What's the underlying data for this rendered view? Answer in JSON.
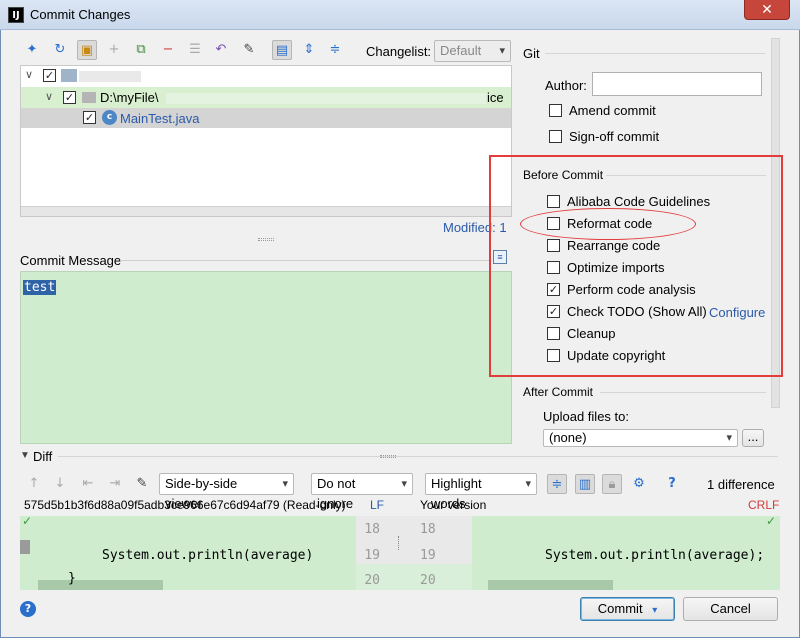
{
  "window": {
    "title": "Commit Changes",
    "app_icon": "intellij-icon",
    "close_glyph": "✕"
  },
  "toolbar": {
    "icons": [
      "show-diff-icon",
      "refresh-icon",
      "group-by-icon",
      "add-icon",
      "move-icon",
      "remove-icon",
      "rollback-tb-icon",
      "revert-icon",
      "edit-source-icon",
      "collapse-icon",
      "expand-all-icon",
      "collapse-all-icon"
    ],
    "changelist_label": "Changelist:",
    "changelist_value": "Default"
  },
  "tree": {
    "root_expand": "∨",
    "path_expand": "∨",
    "path_prefix": "D:\\myFile\\",
    "path_suffix": "ice",
    "file_name": "MainTest.java"
  },
  "modified_label": "Modified: 1",
  "commit_message": {
    "label": "Commit Message",
    "value": "test"
  },
  "git": {
    "section_title": "Git",
    "author_label": "Author:",
    "author_value": "",
    "amend_label": "Amend commit",
    "signoff_label": "Sign-off commit"
  },
  "before_commit": {
    "title": "Before Commit",
    "options": [
      {
        "label": "Alibaba Code Guidelines",
        "checked": false
      },
      {
        "label": "Reformat code",
        "checked": false
      },
      {
        "label": "Rearrange code",
        "checked": false
      },
      {
        "label": "Optimize imports",
        "checked": false
      },
      {
        "label": "Perform code analysis",
        "checked": true
      },
      {
        "label": "Check TODO (Show All)",
        "checked": true
      },
      {
        "label": "Cleanup",
        "checked": false
      },
      {
        "label": "Update copyright",
        "checked": false
      }
    ],
    "configure_link": "Configure"
  },
  "after_commit": {
    "title": "After Commit",
    "upload_label": "Upload files to:",
    "upload_value": "(none)",
    "browse_label": "..."
  },
  "diff": {
    "title": "Diff",
    "viewer": "Side-by-side viewer",
    "whitespace": "Do not ignore",
    "highlight": "Highlight words",
    "difference_count": "1 difference",
    "left_header": "575d5b1b3f6d88a09f5adb3ce966e67c6d94af79 (Read-only)",
    "left_line_sep": "LF",
    "right_header": "Your version",
    "right_line_sep": "CRLF",
    "left_lines": [
      "18",
      "19",
      "20"
    ],
    "right_lines": [
      "18",
      "19",
      "20"
    ],
    "left_code": "System.out.println(average)",
    "right_code": "System.out.println(average);",
    "left_brace": "}"
  },
  "buttons": {
    "commit": "Commit",
    "cancel": "Cancel",
    "help": "?"
  },
  "colors": {
    "highlight_box": "#e23c3c",
    "diff_green": "#cfeccf",
    "link": "#2a5aa9"
  }
}
